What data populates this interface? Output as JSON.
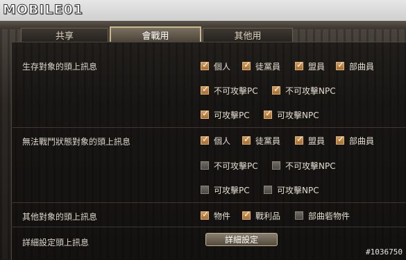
{
  "banner": {
    "logo_text": "MOBILE01"
  },
  "tabs": [
    {
      "label": "共享",
      "active": false
    },
    {
      "label": "會戰用",
      "active": true
    },
    {
      "label": "其他用",
      "active": false
    }
  ],
  "sections": {
    "survival": {
      "label": "生存對象的頭上訊息",
      "options": {
        "personal": {
          "label": "個人",
          "checked": true
        },
        "party": {
          "label": "徒黨員",
          "checked": true
        },
        "alliance": {
          "label": "盟員",
          "checked": true
        },
        "clan": {
          "label": "部曲員",
          "checked": true
        },
        "non_attack_pc": {
          "label": "不可攻擊PC",
          "checked": true
        },
        "non_attack_npc": {
          "label": "不可攻擊NPC",
          "checked": true
        },
        "attack_pc": {
          "label": "可攻擊PC",
          "checked": true
        },
        "attack_npc": {
          "label": "可攻擊NPC",
          "checked": true
        }
      }
    },
    "incapacitated": {
      "label": "無法戰鬥狀態對象的頭上訊息",
      "options": {
        "personal": {
          "label": "個人",
          "checked": true
        },
        "party": {
          "label": "徒黨員",
          "checked": true
        },
        "alliance": {
          "label": "盟員",
          "checked": true
        },
        "clan": {
          "label": "部曲員",
          "checked": true
        },
        "non_attack_pc": {
          "label": "不可攻擊PC",
          "checked": false
        },
        "non_attack_npc": {
          "label": "不可攻擊NPC",
          "checked": false
        },
        "attack_pc": {
          "label": "可攻擊PC",
          "checked": false
        },
        "attack_npc": {
          "label": "可攻擊NPC",
          "checked": false
        }
      }
    },
    "others": {
      "label": "其他對象的頭上訊息",
      "options": {
        "objects": {
          "label": "物件",
          "checked": true
        },
        "loot": {
          "label": "戰利品",
          "checked": true
        },
        "clan_objects": {
          "label": "部曲砦物件",
          "checked": false
        }
      }
    },
    "detail": {
      "label": "詳細設定頭上訊息",
      "button_label": "詳細設定"
    }
  },
  "watermark": "#1036750",
  "colors": {
    "checkbox_on": "#c98a45",
    "checkbox_off": "#5d5953",
    "text": "#dcd6cc"
  }
}
